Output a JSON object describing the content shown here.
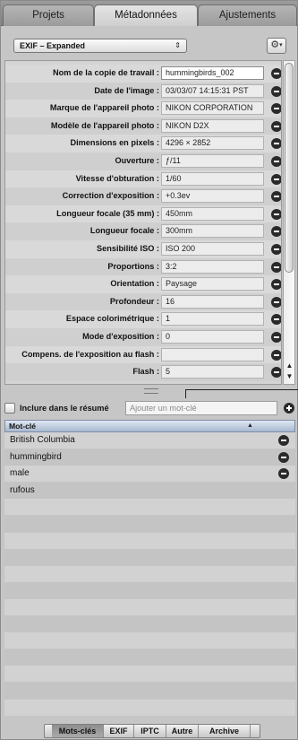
{
  "tabs": {
    "items": [
      {
        "label": "Projets"
      },
      {
        "label": "Métadonnées"
      },
      {
        "label": "Ajustements"
      }
    ],
    "active": "Métadonnées"
  },
  "preset": {
    "value": "EXIF – Expanded",
    "arrows": "⇕",
    "gear": "⚙",
    "gear_caret": "▾"
  },
  "exif": {
    "fields": [
      {
        "label": "Nom de la copie de travail :",
        "value": "hummingbirds_002"
      },
      {
        "label": "Date de l'image :",
        "value": "03/03/07 14:15:31 PST"
      },
      {
        "label": "Marque de l'appareil photo :",
        "value": "NIKON CORPORATION"
      },
      {
        "label": "Modèle de l'appareil photo :",
        "value": "NIKON D2X"
      },
      {
        "label": "Dimensions en pixels :",
        "value": "4296 × 2852"
      },
      {
        "label": "Ouverture :",
        "value": "ƒ/11"
      },
      {
        "label": "Vitesse d'obturation :",
        "value": "1/60"
      },
      {
        "label": "Correction d'exposition :",
        "value": "+0.3ev"
      },
      {
        "label": "Longueur focale (35 mm) :",
        "value": "450mm"
      },
      {
        "label": "Longueur focale :",
        "value": "300mm"
      },
      {
        "label": "Sensibilité ISO :",
        "value": "ISO 200"
      },
      {
        "label": "Proportions :",
        "value": "3:2"
      },
      {
        "label": "Orientation :",
        "value": "Paysage"
      },
      {
        "label": "Profondeur :",
        "value": "16"
      },
      {
        "label": "Espace colorimétrique :",
        "value": "1"
      },
      {
        "label": "Mode d'exposition :",
        "value": "0"
      },
      {
        "label": "Compens. de l'exposition au flash :",
        "value": ""
      },
      {
        "label": "Flash :",
        "value": "5"
      }
    ],
    "scroll_up": "▲",
    "scroll_down": "▼"
  },
  "keywords": {
    "include_label": "Inclure dans le résumé",
    "input_placeholder": "Ajouter un mot-clé",
    "header": "Mot-clé",
    "sort_glyph": "▲",
    "items": [
      "British Columbia",
      "hummingbird",
      "male",
      "rufous"
    ]
  },
  "bottom_tabs": {
    "items": [
      {
        "label": "Mots-clés"
      },
      {
        "label": "EXIF"
      },
      {
        "label": "IPTC"
      },
      {
        "label": "Autre"
      },
      {
        "label": "Archive"
      }
    ],
    "active": "Mots-clés"
  }
}
